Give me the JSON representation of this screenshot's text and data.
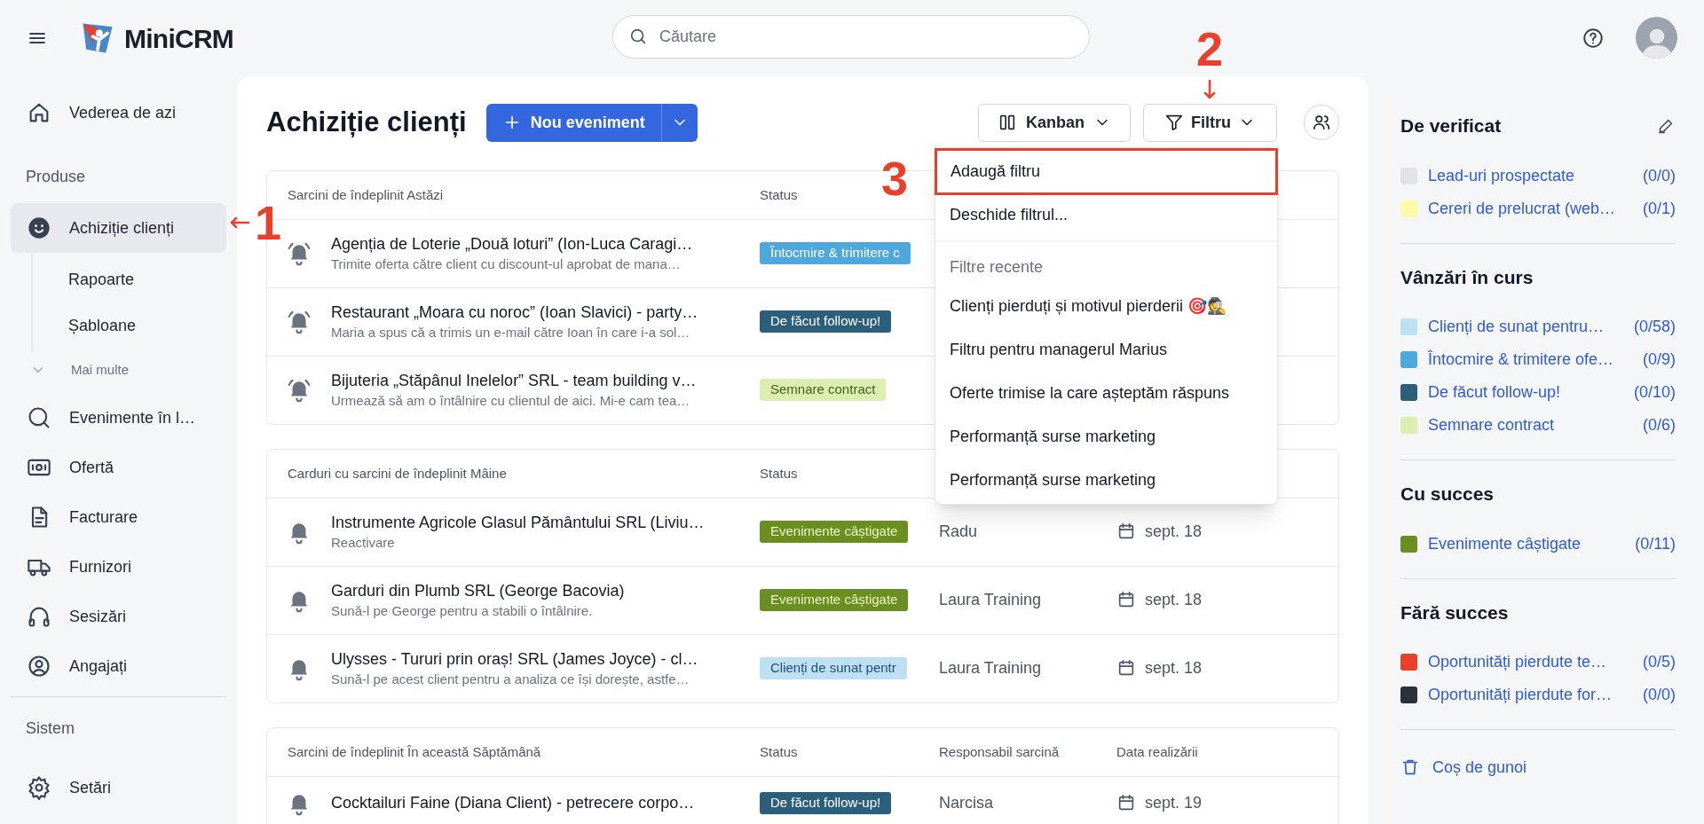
{
  "top_bar": {
    "logo_text": "MiniCRM",
    "search": {
      "placeholder": "Căutare"
    }
  },
  "sidebar": {
    "items": [
      {
        "kind": "item",
        "label": "Vederea de azi",
        "selected": false
      },
      {
        "kind": "section",
        "label": "Produse",
        "divider": false
      },
      {
        "kind": "item",
        "label": "Achiziție clienți",
        "selected": true
      },
      {
        "kind": "subitem",
        "label": "Rapoarte",
        "selected": false
      },
      {
        "kind": "subitem",
        "label": "Șabloane",
        "selected": false
      },
      {
        "kind": "more",
        "label": "Mai multe"
      },
      {
        "kind": "item",
        "label": "Evenimente în l…",
        "selected": false
      },
      {
        "kind": "item",
        "label": "Ofertă",
        "selected": false
      },
      {
        "kind": "item",
        "label": "Facturare",
        "selected": false
      },
      {
        "kind": "item",
        "label": "Furnizori",
        "selected": false
      },
      {
        "kind": "item",
        "label": "Sesizări",
        "selected": false
      },
      {
        "kind": "item",
        "label": "Angajați",
        "selected": false
      },
      {
        "kind": "section",
        "label": "Sistem",
        "divider": true
      },
      {
        "kind": "item",
        "label": "Setări",
        "selected": false
      }
    ]
  },
  "page": {
    "title": "Achiziție clienți",
    "new_button": "Nou eveniment",
    "view_button": "Kanban",
    "filter_button": "Filtru"
  },
  "filter_menu": {
    "items": [
      {
        "kind": "action",
        "label": "Adaugă filtru",
        "outlined": true
      },
      {
        "kind": "action",
        "label": "Deschide filtrul...",
        "outlined": false
      },
      {
        "kind": "header",
        "label": "Filtre recente"
      },
      {
        "kind": "recent",
        "label": "Clienți pierduți și motivul pierderii 🎯🕵️",
        "outlined": false
      },
      {
        "kind": "recent",
        "label": "Filtru pentru managerul Marius",
        "outlined": false
      },
      {
        "kind": "recent",
        "label": "Oferte trimise la care așteptăm răspuns",
        "outlined": false
      },
      {
        "kind": "recent",
        "label": "Performanță surse marketing",
        "outlined": false
      },
      {
        "kind": "recent",
        "label": "Performanță surse marketing",
        "outlined": false
      }
    ]
  },
  "tables": [
    {
      "columns": [
        "Sarcini de îndeplinit Astăzi",
        "Status"
      ],
      "rows": [
        {
          "ringing": true,
          "title": "Agenția de Loterie „Două loturi” (Ion-Luca Caragi…",
          "subtitle": "Trimite oferta către client cu discount-ul aprobat de mana…",
          "status": {
            "label": "Întocmire & trimitere c",
            "color": "#4ea8de"
          }
        },
        {
          "ringing": true,
          "title": "Restaurant „Moara cu noroc” (Ioan Slavici) - party…",
          "subtitle": "Maria a spus că a trimis un e-mail către Ioan în care i-a sol…",
          "status": {
            "label": "De făcut follow-up!",
            "color": "#2c5f7c"
          }
        },
        {
          "ringing": true,
          "title": "Bijuteria „Stăpânul Inelelor” SRL - team building v…",
          "subtitle": "Urmează să am o întâlnire cu clientul de aici. Mi-e cam tea…",
          "status": {
            "label": "Semnare contract",
            "color": "#dcefb0"
          }
        }
      ]
    },
    {
      "columns": [
        "Carduri cu sarcini de îndeplinit Mâine",
        "Status"
      ],
      "rows": [
        {
          "ringing": false,
          "title": "Instrumente Agricole Glasul Pământului SRL (Liviu…",
          "subtitle": "Reactivare",
          "status": {
            "label": "Evenimente câștigate",
            "color": "#6b8e23"
          },
          "responsible": "Radu",
          "date": "sept. 18"
        },
        {
          "ringing": false,
          "title": "Garduri din Plumb SRL (George Bacovia)",
          "subtitle": "Sună-l pe George pentru a stabili o întâlnire.",
          "status": {
            "label": "Evenimente câștigate",
            "color": "#6b8e23"
          },
          "responsible": "Laura Training",
          "date": "sept. 18"
        },
        {
          "ringing": false,
          "title": "Ulysses - Tururi prin oraș! SRL (James Joyce) - cl…",
          "subtitle": "Sună-l pe acest client pentru a analiza ce își dorește, astfe…",
          "status": {
            "label": "Clienți de sunat pentr",
            "color": "#bde0f3"
          },
          "responsible": "Laura Training",
          "date": "sept. 18"
        }
      ]
    },
    {
      "columns": [
        "Sarcini de îndeplinit În această Săptămână",
        "Status",
        "Responsabil sarcină",
        "Data realizării"
      ],
      "rows": [
        {
          "ringing": false,
          "title": "Cocktailuri Faine (Diana Client) - petrecere corpo…",
          "status": {
            "label": "De făcut follow-up!",
            "color": "#2c5f7c"
          },
          "responsible": "Narcisa",
          "date": "sept. 19"
        }
      ]
    }
  ],
  "right_panel": {
    "sections": [
      {
        "title": "De verificat",
        "editable": true,
        "items": [
          {
            "label": "Lead-uri prospectate",
            "count": "(0/0)",
            "color": "#e1e3e8"
          },
          {
            "label": "Cereri de prelucrat (web…",
            "count": "(0/1)",
            "color": "#fdfba8"
          }
        ]
      },
      {
        "title": "Vânzări în curs",
        "editable": false,
        "items": [
          {
            "label": "Clienți de sunat pentru…",
            "count": "(0/58)",
            "color": "#bde0f3"
          },
          {
            "label": "Întocmire & trimitere ofe…",
            "count": "(0/9)",
            "color": "#4ea8de"
          },
          {
            "label": "De făcut follow-up!",
            "count": "(0/10)",
            "color": "#2c5f7c"
          },
          {
            "label": "Semnare contract",
            "count": "(0/6)",
            "color": "#dcefb0"
          }
        ]
      },
      {
        "title": "Cu succes",
        "editable": false,
        "items": [
          {
            "label": "Evenimente câștigate",
            "count": "(0/11)",
            "color": "#6b8e23"
          }
        ]
      },
      {
        "title": "Fără succes",
        "editable": false,
        "items": [
          {
            "label": "Oportunități pierdute te…",
            "count": "(0/5)",
            "color": "#e8402a"
          },
          {
            "label": "Oportunități pierdute for…",
            "count": "(0/0)",
            "color": "#2a303c"
          }
        ]
      }
    ],
    "trash_link": "Coș de gunoi"
  },
  "annotations": [
    {
      "label": "1",
      "kind": "left-arrow"
    },
    {
      "label": "2",
      "kind": "down-arrow"
    },
    {
      "label": "3",
      "kind": "plain"
    }
  ]
}
